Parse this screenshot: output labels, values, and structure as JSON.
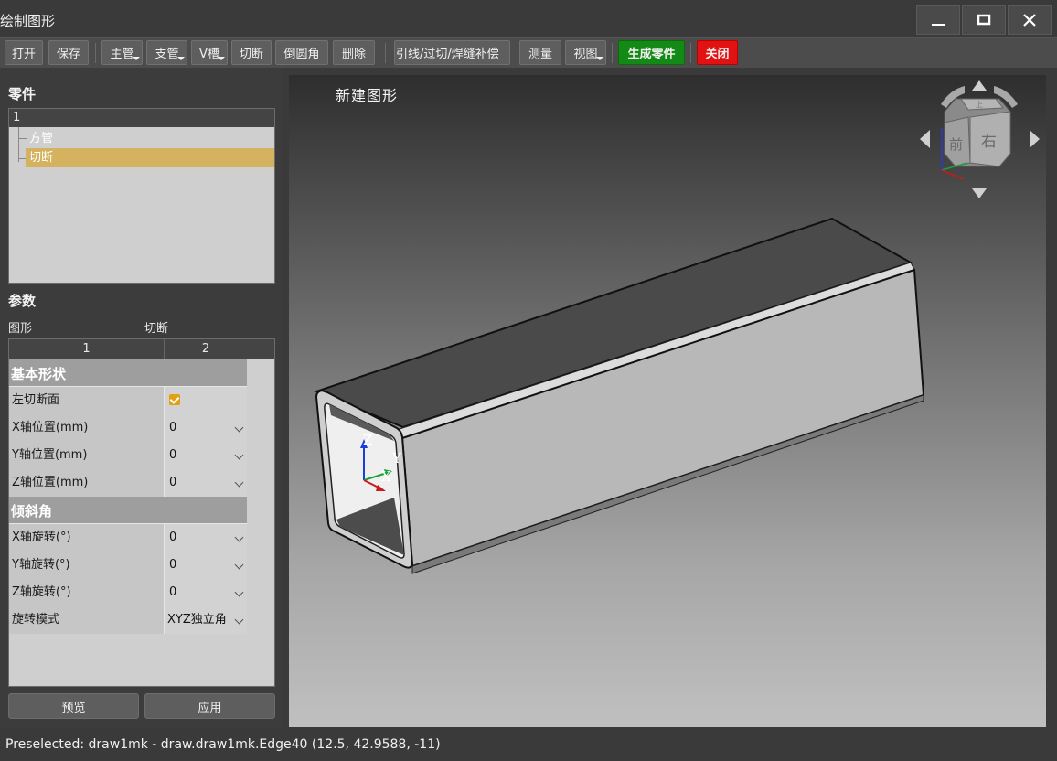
{
  "window": {
    "title": "绘制图形"
  },
  "toolbar": {
    "open": "打开",
    "save": "保存",
    "main_pipe": "主管",
    "branch_pipe": "支管",
    "v_groove": "V槽",
    "cut": "切断",
    "fillet": "倒圆角",
    "delete": "删除",
    "lead_weld": "引线/过切/焊缝补偿",
    "measure": "测量",
    "view": "视图",
    "generate": "生成零件",
    "close": "关闭"
  },
  "parts": {
    "title": "零件",
    "header": "1",
    "items": [
      "方管",
      "切断"
    ],
    "selected_index": 1
  },
  "params": {
    "title": "参数",
    "label_shape": "图形",
    "label_value": "切断",
    "columns": [
      "1",
      "2"
    ],
    "categories": {
      "basic": "基本形状",
      "tilt": "倾斜角"
    },
    "rows": {
      "left_cut": {
        "label": "左切断面",
        "checked": true
      },
      "x_pos": {
        "label": "X轴位置(mm)",
        "value": "0"
      },
      "y_pos": {
        "label": "Y轴位置(mm)",
        "value": "0"
      },
      "z_pos": {
        "label": "Z轴位置(mm)",
        "value": "0"
      },
      "x_rot": {
        "label": "X轴旋转(°)",
        "value": "0"
      },
      "y_rot": {
        "label": "Y轴旋转(°)",
        "value": "0"
      },
      "z_rot": {
        "label": "Z轴旋转(°)",
        "value": "0"
      },
      "rot_mode": {
        "label": "旋转模式",
        "value": "XYZ独立角"
      }
    },
    "preview": "预览",
    "apply": "应用"
  },
  "viewport": {
    "title": "新建图形",
    "axes": {
      "x": "X",
      "y": "Y",
      "z": "Z"
    },
    "navcube": {
      "top": "上",
      "front": "前",
      "right": "右"
    }
  },
  "status": {
    "text": "Preselected: draw1mk - draw.draw1mk.Edge40 (12.5, 42.9588, -11)"
  },
  "colors": {
    "selected_row": "#d4b25f",
    "generate": "#138a15",
    "close": "#e21212",
    "checkbox": "#e0a214"
  }
}
